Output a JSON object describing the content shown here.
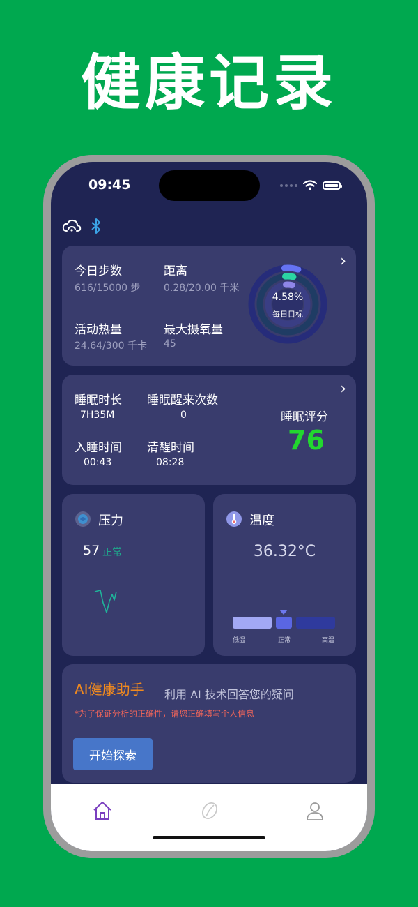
{
  "headline": "健康记录",
  "status_bar": {
    "time": "09:45"
  },
  "top_icons": [
    "cloud-sync-icon",
    "bluetooth-icon"
  ],
  "activity": {
    "steps_label": "今日步数",
    "steps_value": "616/15000 步",
    "distance_label": "距离",
    "distance_value": "0.28/20.00 千米",
    "calories_label": "活动热量",
    "calories_value": "24.64/300 千卡",
    "vo2_label": "最大摄氧量",
    "vo2_value": "45",
    "ring_percent": "4.58%",
    "ring_label": "每日目标",
    "goal_fraction": 0.0458
  },
  "sleep": {
    "duration_label": "睡眠时长",
    "duration_value": "7H35M",
    "wake_count_label": "睡眠醒来次数",
    "wake_count_value": "0",
    "bedtime_label": "入睡时间",
    "bedtime_value": "00:43",
    "wake_time_label": "清醒时间",
    "wake_time_value": "08:28",
    "score_label": "睡眠评分",
    "score_value": "76"
  },
  "stress": {
    "title": "压力",
    "value": "57",
    "status": "正常"
  },
  "temperature": {
    "title": "温度",
    "value": "36.32°C",
    "scale_low": "低温",
    "scale_normal": "正常",
    "scale_high": "高温"
  },
  "ai_assistant": {
    "title": "AI健康助手",
    "subtitle": "利用 AI 技术回答您的疑问",
    "notice": "*为了保证分析的正确性，请您正确填写个人信息",
    "button": "开始探索"
  },
  "tabs": [
    "home-icon",
    "sleep-tab-icon",
    "profile-icon"
  ],
  "colors": {
    "screen_bg": "#1f2453",
    "card_bg": "#393c6d",
    "score_green": "#22d72f",
    "ai_orange": "#f18a1e",
    "notice_red": "#f0655a",
    "button_blue": "#4776c9",
    "stress_normal": "#1fa88c",
    "tab_active": "#7a3fbf"
  }
}
